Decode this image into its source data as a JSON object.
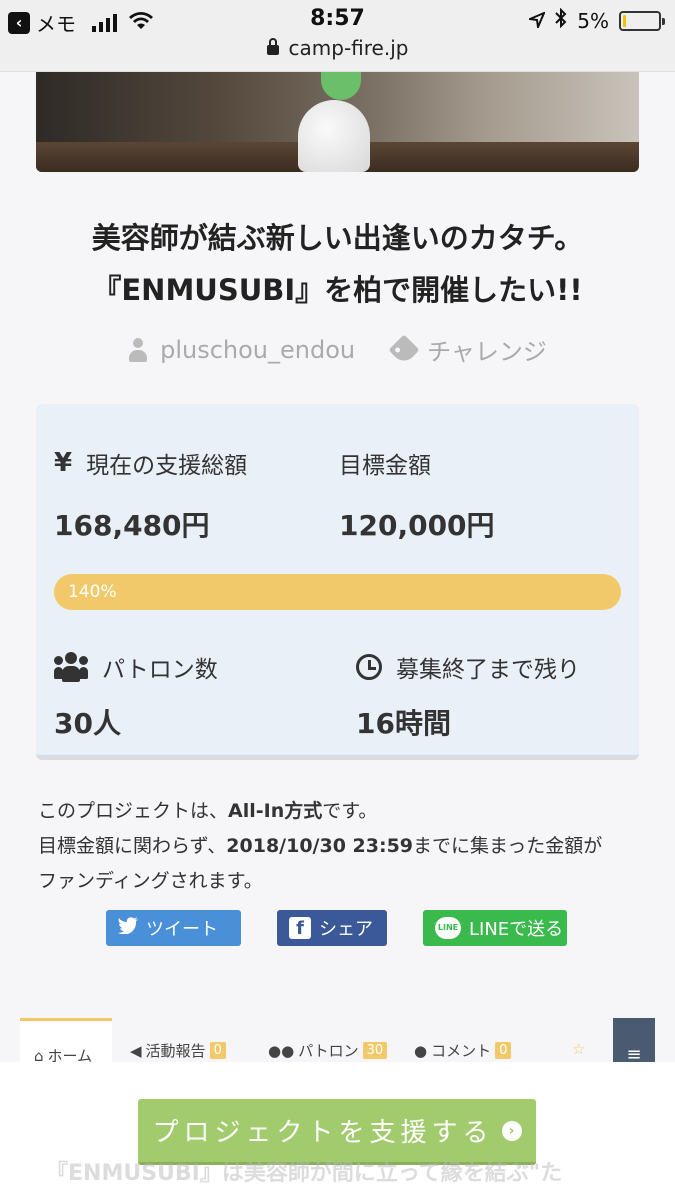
{
  "status_bar": {
    "back_app": "メモ",
    "time": "8:57",
    "battery": "5%",
    "url": "camp-fire.jp"
  },
  "project": {
    "title_line1": "美容師が結ぶ新しい出逢いのカタチ。",
    "title_line2": "『ENMUSUBI』を柏で開催したい!!",
    "author": "pluschou_endou",
    "category": "チャレンジ"
  },
  "stats": {
    "current_label": "現在の支援総額",
    "current_value": "168,480円",
    "goal_label": "目標金額",
    "goal_value": "120,000円",
    "progress_percent": 140,
    "progress_text": "140%",
    "patrons_label": "パトロン数",
    "patrons_value": "30人",
    "remaining_label": "募集終了まで残り",
    "remaining_value": "16時間"
  },
  "notice": {
    "line1_a": "このプロジェクトは、",
    "line1_b": "All-In方式",
    "line1_c": "です。",
    "line2_a": "目標金額に関わらず、",
    "line2_b": "2018/10/30 23:59",
    "line2_c": "までに集まった金額が",
    "line3": "ファンディングされます。"
  },
  "share": {
    "tweet": "ツイート",
    "facebook": "シェア",
    "line": "LINEで送る",
    "line_icon_text": "LINE"
  },
  "tabs": {
    "home": "ホーム",
    "activity": "活動報告",
    "activity_count": "0",
    "patrons": "パトロン",
    "patrons_count": "30",
    "comments": "コメント",
    "comments_count": "0"
  },
  "cta": {
    "support": "プロジェクトを支援する",
    "under_text": "『ENMUSUBI』は美容師が間に立って縁を結ぶ\"た"
  },
  "colors": {
    "progress": "#f1c96a",
    "support_button": "#a2cb6e",
    "twitter": "#4a90d9",
    "facebook": "#3b5998",
    "line": "#3ab94c"
  }
}
